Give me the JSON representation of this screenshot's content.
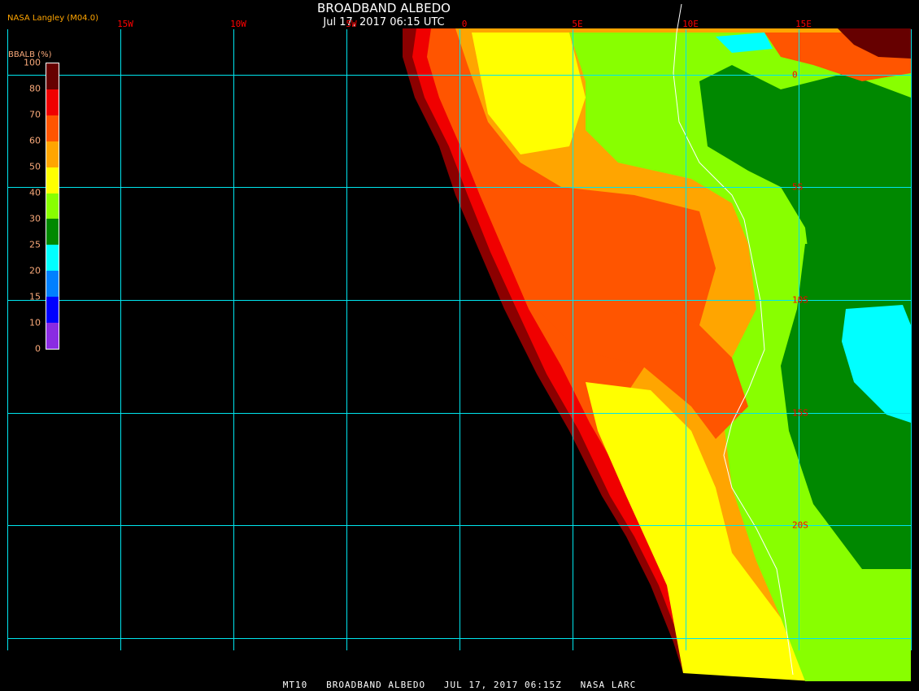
{
  "header": {
    "title": "BROADBAND ALBEDO",
    "subtitle": "Jul 17, 2017 06:15 UTC",
    "credit": "NASA Langley (M04.0)"
  },
  "footer": "MT10   BROADBAND ALBEDO   JUL 17, 2017 06:15Z   NASA LARC",
  "grid": {
    "lon_labels": [
      "15W",
      "10W",
      "5W",
      "0",
      "5E",
      "10E",
      "15E"
    ],
    "lat_labels": [
      "0",
      "5S",
      "10S",
      "15S",
      "20S"
    ]
  },
  "legend": {
    "title": "BBALB (%)",
    "ticks": [
      "100",
      "80",
      "70",
      "60",
      "50",
      "40",
      "30",
      "25",
      "20",
      "15",
      "10",
      "0"
    ],
    "colors": [
      "#660000",
      "#f00000",
      "#ff5500",
      "#ffa500",
      "#ffff00",
      "#88ff00",
      "#008800",
      "#00ffff",
      "#0080ff",
      "#0000ff",
      "#8a2be2"
    ]
  },
  "colors": {
    "grid": "#00e5ee",
    "label": "#ff0000",
    "coast": "#ffffff"
  }
}
